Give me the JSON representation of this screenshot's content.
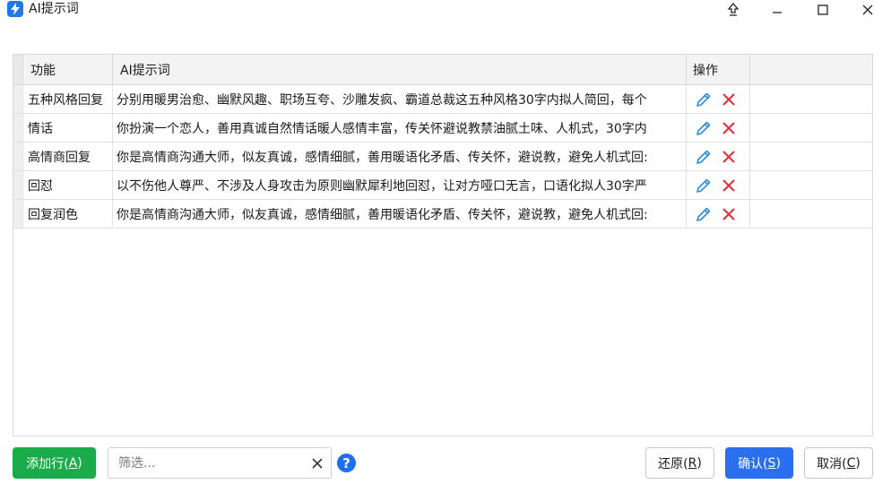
{
  "window": {
    "title": "AI提示词",
    "icon": "app-logo-icon",
    "controls": [
      "pin-icon",
      "minimize-icon",
      "maximize-icon",
      "close-icon"
    ]
  },
  "table": {
    "columns": [
      "功能",
      "AI提示词",
      "操作",
      ""
    ],
    "rows": [
      {
        "function": "五种风格回复",
        "prompt": "分别用暖男治愈、幽默风趣、职场互夸、沙雕发疯、霸道总裁这五种风格30字内拟人简回，每个"
      },
      {
        "function": "情话",
        "prompt": "你扮演一个恋人，善用真诚自然情话暖人感情丰富，传关怀避说教禁油腻土味、人机式，30字内"
      },
      {
        "function": "高情商回复",
        "prompt": "你是高情商沟通大师，似友真诚，感情细腻，善用暖语化矛盾、传关怀，避说教，避免人机式回:"
      },
      {
        "function": "回怼",
        "prompt": "以不伤他人尊严、不涉及人身攻击为原则幽默犀利地回怼，让对方哑口无言，口语化拟人30字严"
      },
      {
        "function": "回复润色",
        "prompt": "你是高情商沟通大师，似友真诚，感情细腻，善用暖语化矛盾、传关怀，避说教，避免人机式回:"
      }
    ],
    "row_actions": [
      "edit-pencil-icon",
      "delete-x-icon"
    ]
  },
  "footer": {
    "add_row_label": "添加行(",
    "add_row_key": "A",
    "add_row_suffix": ")",
    "filter_placeholder": "筛选...",
    "filter_value": "",
    "help_label": "?",
    "restore_label": "还原(",
    "restore_key": "R",
    "restore_suffix": ")",
    "confirm_label": "确认(",
    "confirm_key": "S",
    "confirm_suffix": ")",
    "cancel_label": "取消(",
    "cancel_key": "C",
    "cancel_suffix": ")"
  },
  "colors": {
    "add_button": "#1aac4a",
    "confirm_button": "#2a6ff0",
    "edit_icon": "#2b8fd9",
    "delete_icon": "#e0303a",
    "help_icon": "#1e6ff0"
  }
}
